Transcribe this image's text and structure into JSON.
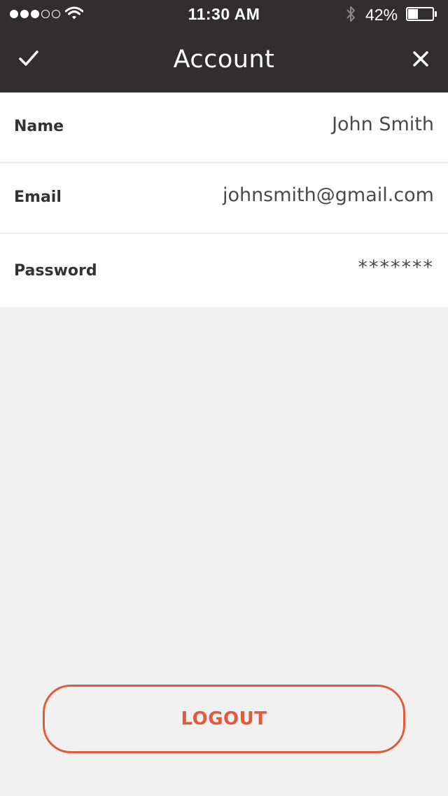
{
  "status_bar": {
    "signal_bars_filled": 3,
    "signal_bars_total": 5,
    "time": "11:30 AM",
    "battery_percent": "42%",
    "battery_level": 0.42,
    "icons": [
      "wifi-icon",
      "bluetooth-icon",
      "battery-icon"
    ]
  },
  "nav": {
    "title": "Account",
    "left_icon": "checkmark-icon",
    "right_icon": "close-icon"
  },
  "fields": [
    {
      "label": "Name",
      "value": "John Smith"
    },
    {
      "label": "Email",
      "value": "johnsmith@gmail.com"
    },
    {
      "label": "Password",
      "value": "*******"
    }
  ],
  "logout_label": "LOGOUT",
  "colors": {
    "header_bg": "#322e30",
    "page_bg": "#f1f1f1",
    "accent": "#e05a3c"
  }
}
